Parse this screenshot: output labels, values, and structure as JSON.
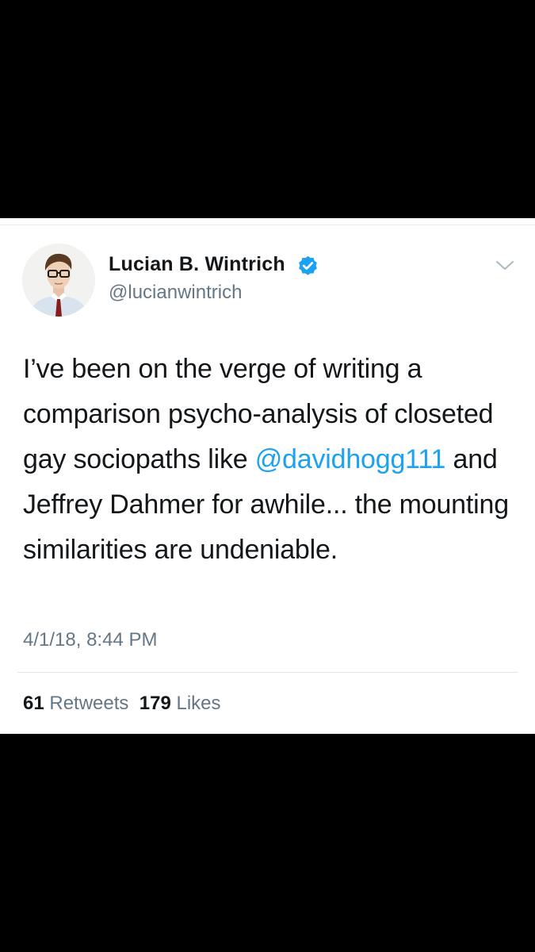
{
  "tweet": {
    "display_name": "Lucian B. Wintrich",
    "handle": "@lucianwintrich",
    "verified": true,
    "text_before_mention": "I’ve been on the verge of writing a comparison psycho-analysis of closeted gay sociopaths like ",
    "mention": "@davidhogg111",
    "text_after_mention": " and Jeffrey Dahmer for awhile... the mounting similarities are undeniable.",
    "timestamp": "4/1/18, 8:44 PM",
    "retweets_count": "61",
    "retweets_label": "Retweets",
    "likes_count": "179",
    "likes_label": "Likes"
  },
  "icons": {
    "verified": "verified-badge-icon",
    "menu": "chevron-down-icon"
  },
  "colors": {
    "background": "#000000",
    "card": "#ffffff",
    "text": "#14171a",
    "secondary_text": "#657786",
    "accent": "#1da1f2"
  }
}
